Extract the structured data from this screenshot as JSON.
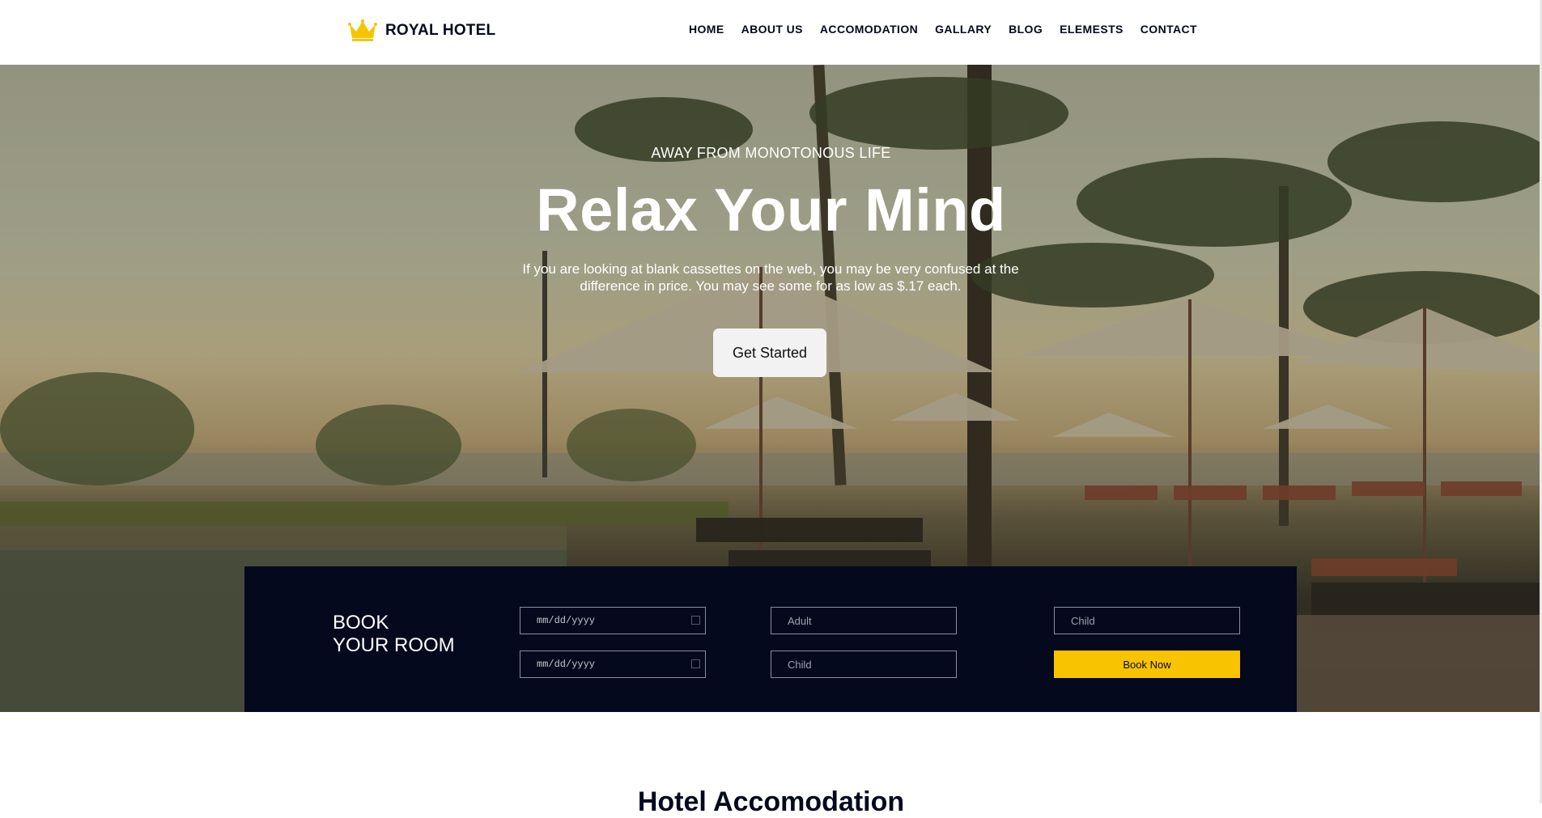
{
  "header": {
    "brand": "ROYAL HOTEL",
    "brand_color": "#f8c301",
    "nav": [
      "HOME",
      "ABOUT US",
      "ACCOMODATION",
      "GALLARY",
      "BLOG",
      "ELEMESTS",
      "CONTACT"
    ]
  },
  "hero": {
    "subtitle": "AWAY FROM MONOTONOUS LIFE",
    "title": "Relax Your Mind",
    "description": "If you are looking at blank cassettes on the web, you may be very confused at the difference in price. You may see some for as low as $.17 each.",
    "button": "Get Started"
  },
  "booking": {
    "title_line1": "BOOK",
    "title_line2": "YOUR ROOM",
    "date_placeholder_1": "mm/dd/yyyy",
    "date_placeholder_2": "mm/dd/yyyy",
    "adult_placeholder": "Adult",
    "child_placeholder_1": "Child",
    "child_placeholder_2": "Child",
    "button": "Book Now",
    "background_color": "#04091e",
    "button_color": "#f8c301"
  },
  "section": {
    "title": "Hotel Accomodation"
  }
}
